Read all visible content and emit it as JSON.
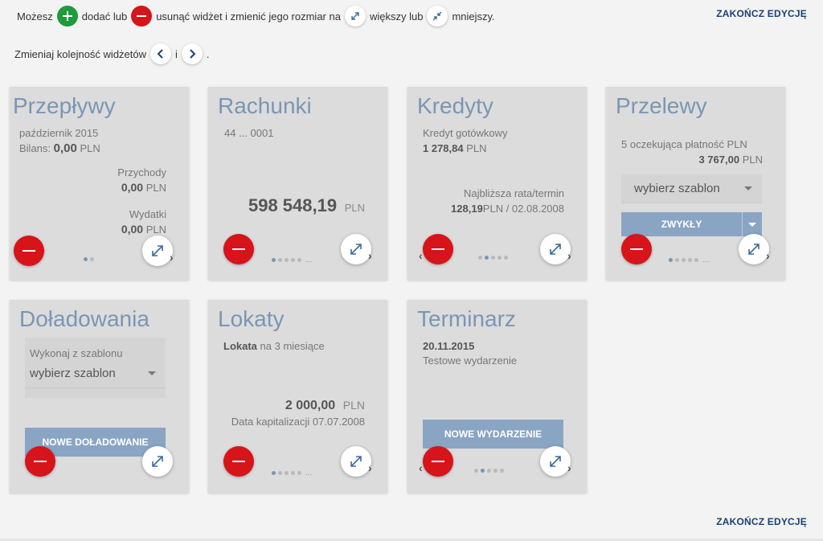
{
  "help": {
    "line1": {
      "t1": "Możesz",
      "t2": "dodać lub",
      "t3": "usunąć widżet i zmienić jego rozmiar na",
      "t4": "większy lub",
      "t5": "mniejszy."
    },
    "line2": {
      "t1": "Zmieniaj kolejność widżetów",
      "t2": "i",
      "t3": "."
    }
  },
  "finish_edit": "ZAKOŃCZ EDYCJĘ",
  "colors": {
    "accent": "#7a96b4",
    "remove": "#d7141a",
    "add": "#1f9a3c",
    "link": "#1b3f7a"
  },
  "widgets": {
    "przeplywy": {
      "title": "Przepływy",
      "period": "październik 2015",
      "balance_label": "Bilans:",
      "balance": "0,00",
      "currency": "PLN",
      "income_label": "Przychody",
      "income": "0,00",
      "expense_label": "Wydatki",
      "expense": "0,00"
    },
    "rachunki": {
      "title": "Rachunki",
      "account": "44 ... 0001",
      "amount": "598 548,19",
      "currency": "PLN"
    },
    "kredyty": {
      "title": "Kredyty",
      "type": "Kredyt gotówkowy",
      "amount": "1 278,84",
      "currency": "PLN",
      "next_label": "Najbliższa rata/termin",
      "next_amount": "128,19",
      "next_rest": "PLN / 02.08.2008"
    },
    "przelewy": {
      "title": "Przelewy",
      "pending": "5 oczekująca płatność PLN",
      "amount": "3 767,00",
      "currency": "PLN",
      "template_select": "wybierz szablon",
      "button": "ZWYKŁY"
    },
    "doladowania": {
      "title": "Doładowania",
      "select_label": "Wykonaj z szablonu",
      "template_select": "wybierz szablon",
      "button": "NOWE DOŁADOWANIE"
    },
    "lokaty": {
      "title": "Lokaty",
      "name": "Lokata",
      "term": "na 3 miesiące",
      "amount": "2 000,00",
      "currency": "PLN",
      "cap_date": "Data kapitalizacji 07.07.2008"
    },
    "terminarz": {
      "title": "Terminarz",
      "date": "20.11.2015",
      "event": "Testowe wydarzenie",
      "button": "NOWE WYDARZENIE"
    }
  }
}
